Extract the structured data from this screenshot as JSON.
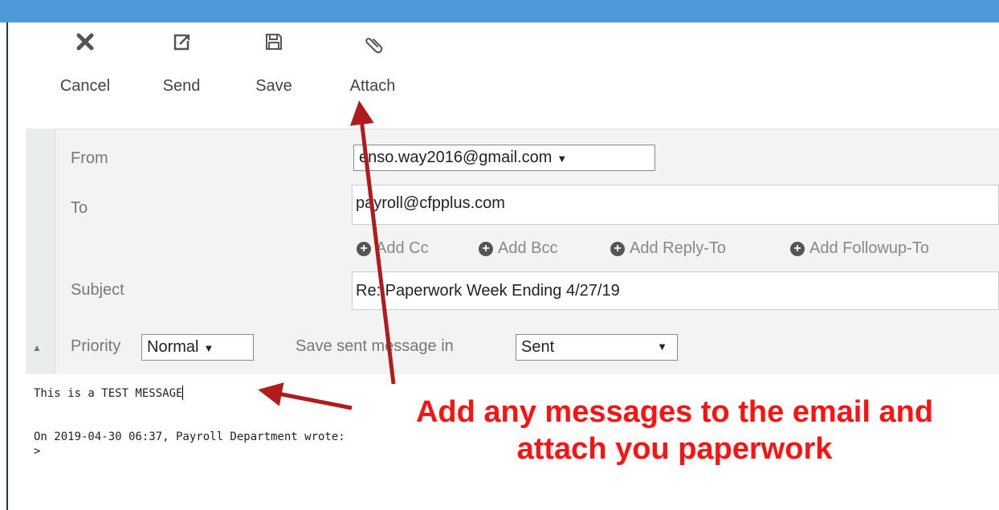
{
  "toolbar": {
    "cancel_label": "Cancel",
    "send_label": "Send",
    "save_label": "Save",
    "attach_label": "Attach"
  },
  "headers": {
    "from_label": "From",
    "from_value": "enso.way2016@gmail.com",
    "to_label": "To",
    "to_value": "payroll@cfpplus.com",
    "add_cc": "Add Cc",
    "add_bcc": "Add Bcc",
    "add_reply_to": "Add Reply-To",
    "add_followup_to": "Add Followup-To",
    "subject_label": "Subject",
    "subject_value": "Re: Paperwork Week Ending 4/27/19",
    "priority_label": "Priority",
    "priority_value": "Normal",
    "save_sent_label": "Save sent message in",
    "save_sent_value": "Sent"
  },
  "message": {
    "line1": "This is a TEST MESSAGE",
    "quote_header": "On 2019-04-30 06:37, Payroll Department wrote:",
    "quote_marker": ">"
  },
  "annotation": {
    "line1": "Add any messages to the email and",
    "line2": "attach you paperwork",
    "color": "#ff1111"
  },
  "colors": {
    "topbar": "#4e9ad9",
    "arrow": "#b01c1c"
  }
}
